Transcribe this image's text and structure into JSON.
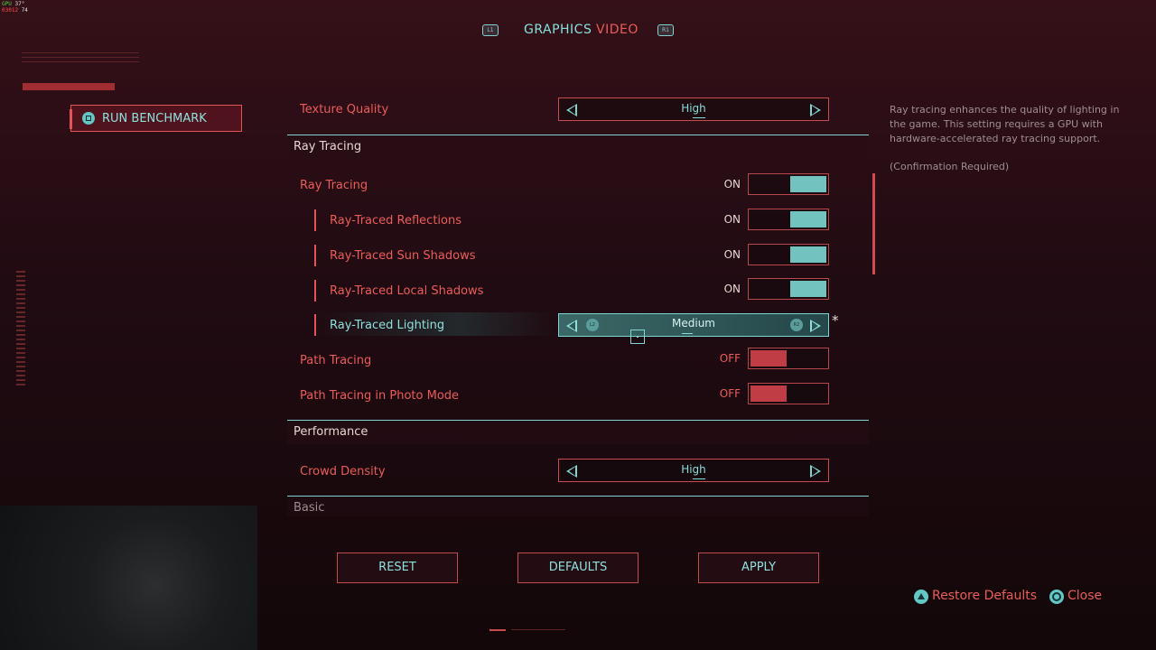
{
  "hud": {
    "gpu_label": "GPU",
    "gpu_temp": "37°",
    "fps_label": "03012",
    "fps_value": "74"
  },
  "nav": {
    "left_shoulder": "L1",
    "right_shoulder": "R1",
    "tabs": [
      {
        "label": "GRAPHICS",
        "active": true
      },
      {
        "label": "VIDEO",
        "active": false
      }
    ]
  },
  "benchmark": {
    "label": "RUN BENCHMARK",
    "icon": "square-button-icon"
  },
  "rows": {
    "texture_quality": {
      "label": "Texture Quality",
      "value": "High"
    },
    "ray_tracing_section": "Ray Tracing",
    "ray_tracing": {
      "label": "Ray Tracing",
      "state": "ON"
    },
    "rt_reflections": {
      "label": "Ray-Traced Reflections",
      "state": "ON"
    },
    "rt_sun_shadows": {
      "label": "Ray-Traced Sun Shadows",
      "state": "ON"
    },
    "rt_local_shadows": {
      "label": "Ray-Traced Local Shadows",
      "state": "ON"
    },
    "rt_lighting": {
      "label": "Ray-Traced Lighting",
      "value": "Medium",
      "l2": "L2",
      "r2": "R2",
      "modified_marker": "*"
    },
    "path_tracing": {
      "label": "Path Tracing",
      "state": "OFF"
    },
    "path_tracing_photo": {
      "label": "Path Tracing in Photo Mode",
      "state": "OFF"
    },
    "performance_section": "Performance",
    "crowd_density": {
      "label": "Crowd Density",
      "value": "High"
    },
    "basic_section": "Basic"
  },
  "description": {
    "text": "Ray tracing enhances the quality of lighting in the game. This setting requires a GPU with hardware-accelerated ray tracing support.",
    "confirmation": "(Confirmation Required)"
  },
  "buttons": {
    "reset": "RESET",
    "defaults": "DEFAULTS",
    "apply": "APPLY"
  },
  "hints": {
    "restore_defaults": "Restore Defaults",
    "close": "Close"
  },
  "colors": {
    "accent_cyan": "#7fd3d0",
    "accent_red": "#ea5c5a",
    "bg": "#200b12"
  }
}
